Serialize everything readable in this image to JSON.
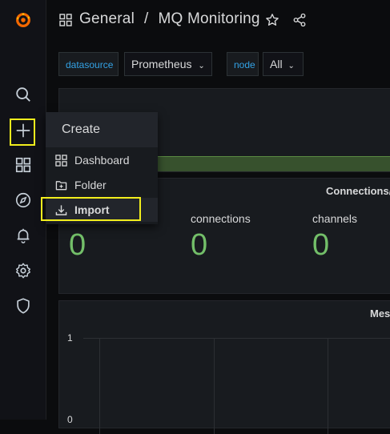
{
  "breadcrumb": {
    "folder": "General",
    "separator": "/",
    "dashboard": "MQ Monitoring"
  },
  "variables": [
    {
      "label": "datasource",
      "value": "Prometheus"
    },
    {
      "label": "node",
      "value": "All"
    }
  ],
  "stats": [
    {
      "title": "connections",
      "value": "0"
    },
    {
      "title": "channels",
      "value": "0"
    },
    {
      "title": "",
      "value": "0"
    }
  ],
  "stats_panel_title": "Connections/",
  "graph_panel": {
    "title": "Mes",
    "y_ticks": [
      "1",
      "0"
    ]
  },
  "create_menu": {
    "title": "Create",
    "items": [
      {
        "label": "Dashboard",
        "icon": "dashboard-grid-icon"
      },
      {
        "label": "Folder",
        "icon": "folder-plus-icon"
      },
      {
        "label": "Import",
        "icon": "import-icon",
        "active": true
      }
    ]
  },
  "sidebar": {
    "icons": [
      "grafana-logo",
      "search-icon",
      "plus-icon",
      "dashboards-icon",
      "explore-compass-icon",
      "alerting-bell-icon",
      "configuration-gear-icon",
      "server-admin-shield-icon"
    ]
  },
  "colors": {
    "accent_highlight": "#f2ee1d",
    "stat_green": "#73bf69",
    "link_blue": "#33a2e5",
    "logo_orange": "#f46800"
  }
}
